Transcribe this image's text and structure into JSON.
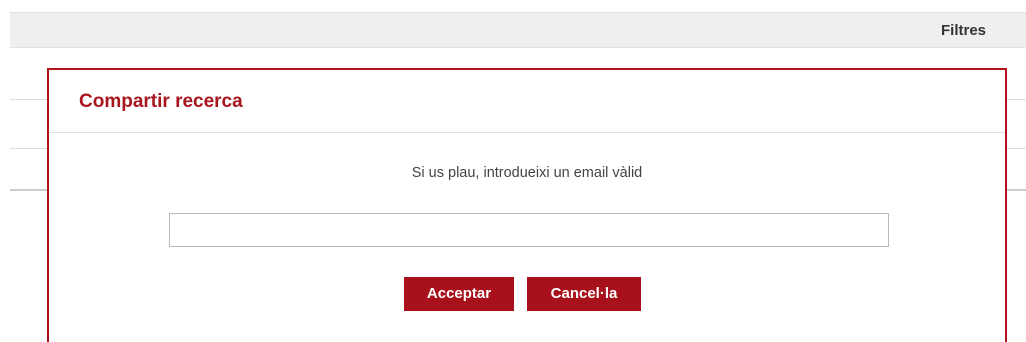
{
  "filters": {
    "label": "Filtres"
  },
  "modal": {
    "title": "Compartir recerca",
    "message": "Si us plau, introdueixi un email vàlid",
    "email_input": {
      "value": "",
      "placeholder": ""
    },
    "accept_label": "Acceptar",
    "cancel_label": "Cancel·la"
  },
  "colors": {
    "accent": "#a8111b",
    "filter_bar_bg": "#efefef"
  }
}
